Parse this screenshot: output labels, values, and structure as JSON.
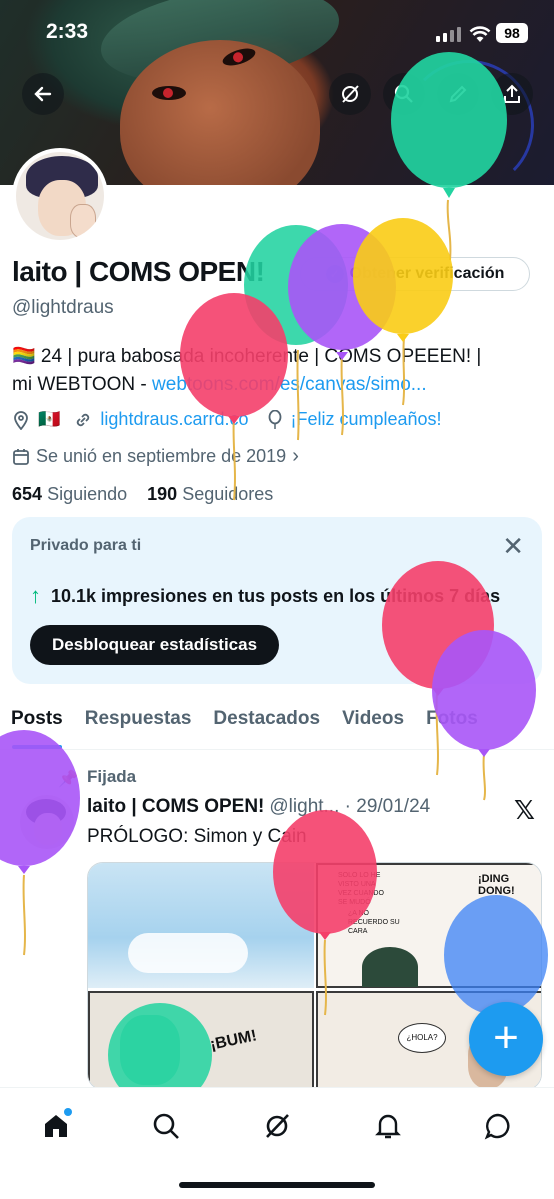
{
  "status_bar": {
    "time": "2:33",
    "battery": "98"
  },
  "profile": {
    "name": "laito | COMS OPEN!",
    "handle": "@lightdraus",
    "verify_label": "Obtener verificación",
    "bio_line1": "🏳️‍🌈 24 | pura babosada incoherente | COMS OPEEEN! |",
    "bio_line2_text": "mi WEBTOON - ",
    "bio_link": "webtoons.com/es/canvas/simo...",
    "flag": "🇲🇽",
    "website": "lightdraus.carrd.co",
    "birthday": "¡Feliz cumpleaños!",
    "joined": "Se unió en septiembre de 2019",
    "following_count": "654",
    "following_label": "Siguiendo",
    "followers_count": "190",
    "followers_label": "Seguidores"
  },
  "private_card": {
    "title": "Privado para ti",
    "stat": "10.1k impresiones en tus posts en los últimos 7 días",
    "button": "Desbloquear estadísticas"
  },
  "tabs": [
    "Posts",
    "Respuestas",
    "Destacados",
    "Videos",
    "Fotos"
  ],
  "pinned_post": {
    "pinned_label": "Fijada",
    "author": "laito | COMS OPEN!",
    "handle_date": "@light... · 29/01/24",
    "text": "PRÓLOGO: Simon y Cain",
    "comic_texts": [
      "SOLO LO HE VISTO UNA VEZ CUANDO SE MUDÓ",
      "¿A NO RECUERDO SU CARA",
      "¿HOLA?",
      "¡BUM!",
      "¡DING DONG!"
    ]
  },
  "balloon_colors": [
    "#22d3a0",
    "#f43f6a",
    "#a855f7",
    "#facc15",
    "#3b82f6"
  ],
  "icons": [
    "back-arrow-icon",
    "grok-icon",
    "search-icon",
    "edit-icon",
    "share-icon",
    "home-icon",
    "search-icon",
    "grok-icon",
    "bell-icon",
    "messages-icon",
    "plus-icon"
  ]
}
